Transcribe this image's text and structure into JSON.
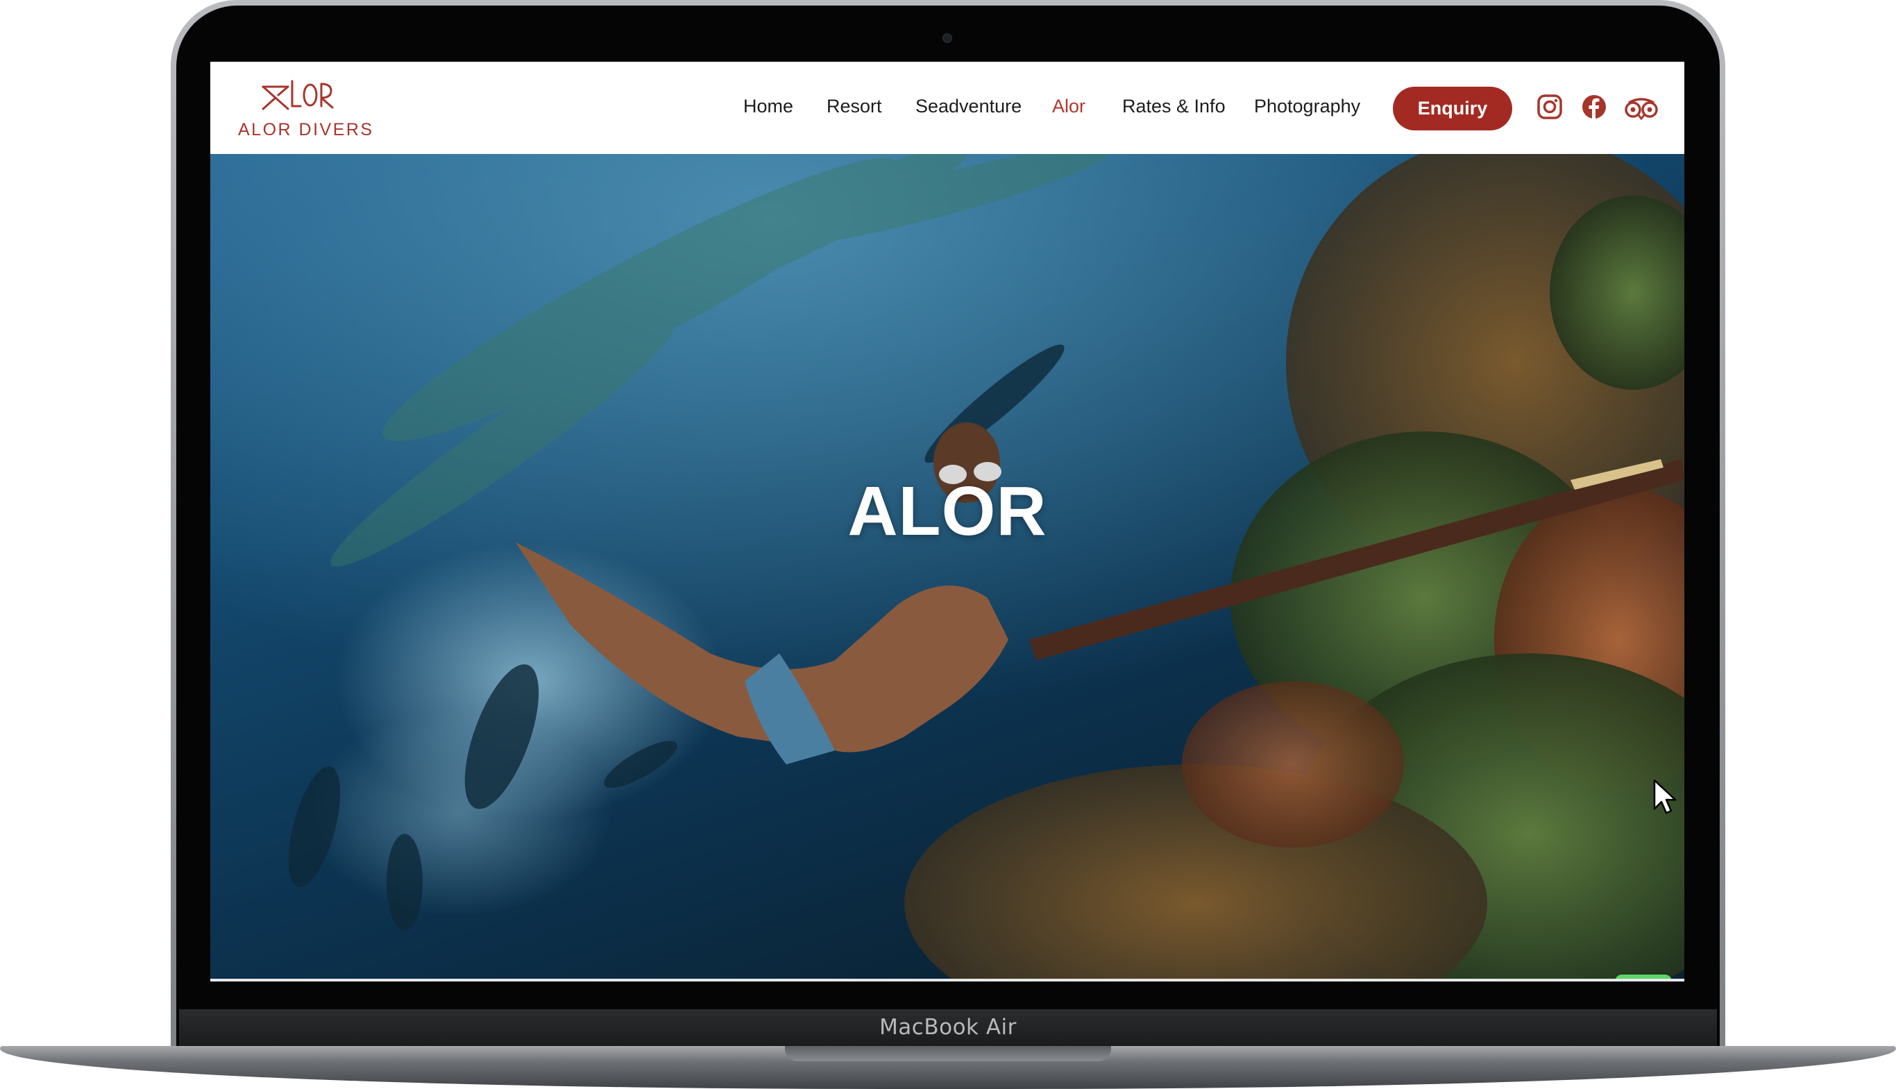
{
  "device": {
    "label": "MacBook Air"
  },
  "brand": {
    "logo_text": "ALOR DIVERS",
    "accent_color": "#a6362c"
  },
  "nav": {
    "items": [
      {
        "label": "Home"
      },
      {
        "label": "Resort"
      },
      {
        "label": "Seadventure"
      },
      {
        "label": "Alor",
        "active": true
      },
      {
        "label": "Rates & Info"
      },
      {
        "label": "Photography"
      }
    ],
    "cta_label": "Enquiry",
    "cta_color": "#a32a22",
    "social_icons": [
      "instagram-icon",
      "facebook-icon",
      "tripadvisor-icon"
    ]
  },
  "hero": {
    "title": "ALOR",
    "background": "underwater photo of free divers spearfishing above a coral reef"
  },
  "floating": {
    "chat_icon": "whatsapp-icon",
    "chat_color": "#2cb742"
  }
}
